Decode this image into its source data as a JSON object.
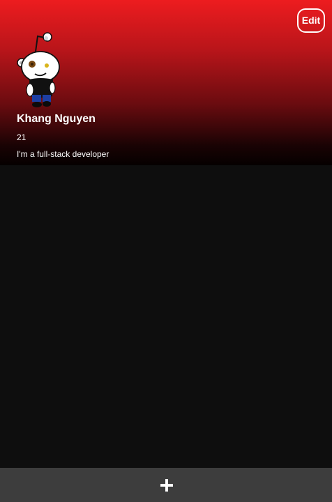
{
  "profile": {
    "name": "Khang Nguyen",
    "age": "21",
    "bio": "I'm a full-stack developer",
    "avatar_icon": "snoo-avatar-icon"
  },
  "header": {
    "edit_label": "Edit",
    "gradient_top_color": "#ed1c1f",
    "gradient_bottom_color": "#050000"
  },
  "bottom_bar": {
    "add_icon": "plus-icon",
    "background_color": "#3d3d3d"
  },
  "theme": {
    "background_color": "#0e0e0e",
    "text_color": "#ffffff"
  }
}
